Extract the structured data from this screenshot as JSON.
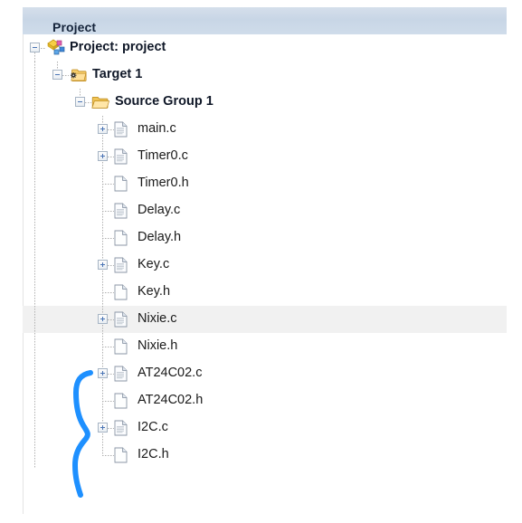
{
  "panel": {
    "header_title": "Project"
  },
  "tree": {
    "nodes": [
      {
        "label": "Project: project",
        "type": "project",
        "depth": 0,
        "expander": "minus",
        "icon": "project-icon",
        "bold": true,
        "selected": false
      },
      {
        "label": "Target 1",
        "type": "target",
        "depth": 1,
        "expander": "minus",
        "icon": "target-folder-icon",
        "bold": true,
        "selected": false
      },
      {
        "label": "Source Group 1",
        "type": "group",
        "depth": 2,
        "expander": "minus",
        "icon": "open-folder-icon",
        "bold": true,
        "selected": false
      },
      {
        "label": "main.c",
        "type": "source-file",
        "depth": 3,
        "expander": "plus",
        "icon": "c-file-icon",
        "bold": false,
        "selected": false
      },
      {
        "label": "Timer0.c",
        "type": "source-file",
        "depth": 3,
        "expander": "plus",
        "icon": "c-file-icon",
        "bold": false,
        "selected": false
      },
      {
        "label": "Timer0.h",
        "type": "header-file",
        "depth": 3,
        "expander": "none",
        "icon": "h-file-icon",
        "bold": false,
        "selected": false
      },
      {
        "label": "Delay.c",
        "type": "source-file",
        "depth": 3,
        "expander": "none",
        "icon": "c-file-icon",
        "bold": false,
        "selected": false
      },
      {
        "label": "Delay.h",
        "type": "header-file",
        "depth": 3,
        "expander": "none",
        "icon": "h-file-icon",
        "bold": false,
        "selected": false
      },
      {
        "label": "Key.c",
        "type": "source-file",
        "depth": 3,
        "expander": "plus",
        "icon": "c-file-icon",
        "bold": false,
        "selected": false
      },
      {
        "label": "Key.h",
        "type": "header-file",
        "depth": 3,
        "expander": "none",
        "icon": "h-file-icon",
        "bold": false,
        "selected": false
      },
      {
        "label": "Nixie.c",
        "type": "source-file",
        "depth": 3,
        "expander": "plus",
        "icon": "c-file-icon",
        "bold": false,
        "selected": true
      },
      {
        "label": "Nixie.h",
        "type": "header-file",
        "depth": 3,
        "expander": "none",
        "icon": "h-file-icon",
        "bold": false,
        "selected": false
      },
      {
        "label": "AT24C02.c",
        "type": "source-file",
        "depth": 3,
        "expander": "plus",
        "icon": "c-file-icon",
        "bold": false,
        "selected": false
      },
      {
        "label": "AT24C02.h",
        "type": "header-file",
        "depth": 3,
        "expander": "none",
        "icon": "h-file-icon",
        "bold": false,
        "selected": false
      },
      {
        "label": "I2C.c",
        "type": "source-file",
        "depth": 3,
        "expander": "plus",
        "icon": "c-file-icon",
        "bold": false,
        "selected": false
      },
      {
        "label": "I2C.h",
        "type": "header-file",
        "depth": 3,
        "expander": "none",
        "icon": "h-file-icon",
        "bold": false,
        "selected": false
      }
    ]
  },
  "annotation": {
    "shape": "hand-drawn-brace",
    "color": "#1e90ff",
    "covers": [
      "AT24C02.c",
      "AT24C02.h",
      "I2C.c",
      "I2C.h"
    ]
  },
  "colors": {
    "header_bg": "#cfdcea",
    "header_text": "#15243b",
    "selection_bg": "#f1f1f1",
    "tree_line": "#b0b0b0",
    "text": "#1a1a1a",
    "annotation_blue": "#1e90ff"
  }
}
